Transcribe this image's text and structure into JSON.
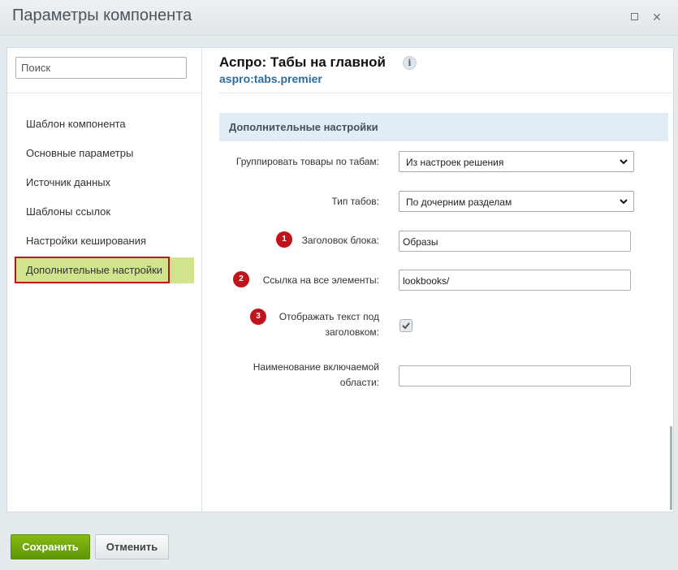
{
  "window": {
    "title": "Параметры компонента",
    "maximize_icon": "maximize-icon",
    "close_icon": "close-icon"
  },
  "sidebar": {
    "search_placeholder": "Поиск",
    "items": [
      {
        "label": "Шаблон компонента"
      },
      {
        "label": "Основные параметры"
      },
      {
        "label": "Источник данных"
      },
      {
        "label": "Шаблоны ссылок"
      },
      {
        "label": "Настройки кеширования"
      },
      {
        "label": "Дополнительные настройки",
        "active": true
      }
    ],
    "active_color": "#d1e38d",
    "highlight_border_color": "#c3111a"
  },
  "component": {
    "title": "Аспро: Табы на главной",
    "code": "aspro:tabs.premier"
  },
  "section": {
    "title": "Дополнительные настройки"
  },
  "fields": {
    "group_by_tabs": {
      "label": "Группировать товары по табам:",
      "value": "Из настроек решения"
    },
    "tabs_type": {
      "label": "Тип табов:",
      "value": "По дочерним разделам"
    },
    "block_title": {
      "badge": "1",
      "label": "Заголовок блока:",
      "value": "Образы"
    },
    "all_link": {
      "badge": "2",
      "label": "Ссылка на все элементы:",
      "value": "lookbooks/"
    },
    "show_text": {
      "badge": "3",
      "label_line1": "Отображать текст под",
      "label_line2": "заголовком:",
      "checked": true
    },
    "include_area": {
      "label_line1": "Наименование включаемой",
      "label_line2": "области:",
      "value": ""
    }
  },
  "footer": {
    "save_label": "Сохранить",
    "cancel_label": "Отменить",
    "save_color": "#6fa70c"
  }
}
